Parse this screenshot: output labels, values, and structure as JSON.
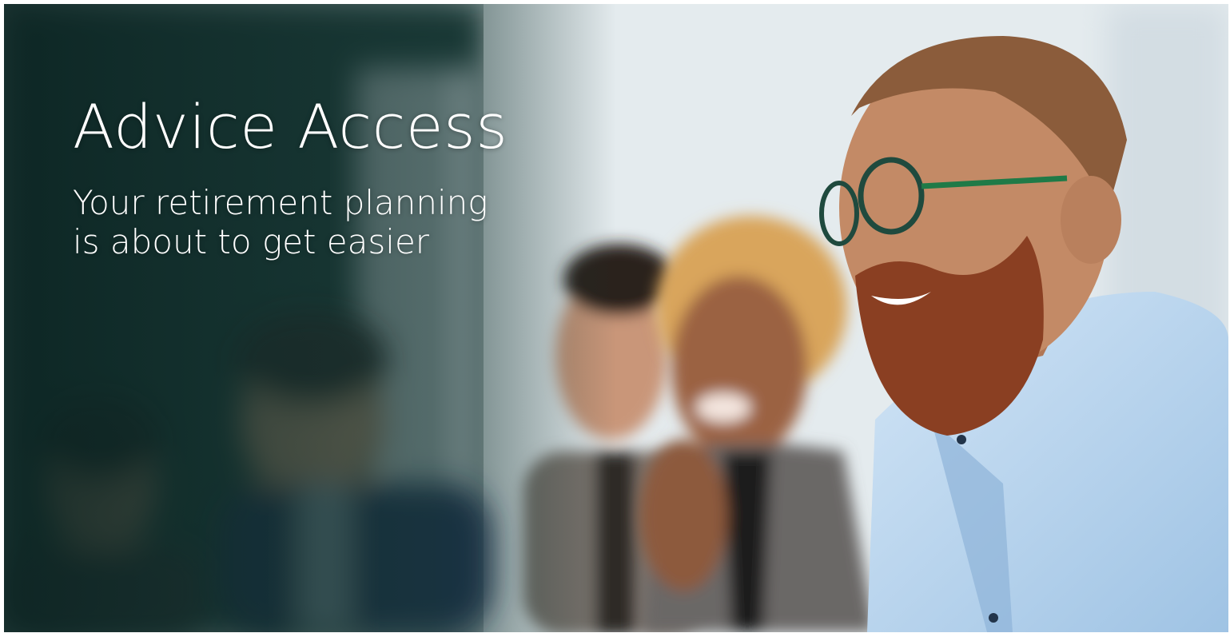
{
  "hero": {
    "title": "Advice Access",
    "subtitle_line1": "Your retirement planning",
    "subtitle_line2": "is about to get easier"
  },
  "colors": {
    "dark_teal": "#173a36",
    "light_wall": "#e6ecef",
    "shirt_blue": "#b9d7ef",
    "text": "#ffffff"
  },
  "image": {
    "subject": "group-of-smiling-people-photo"
  }
}
